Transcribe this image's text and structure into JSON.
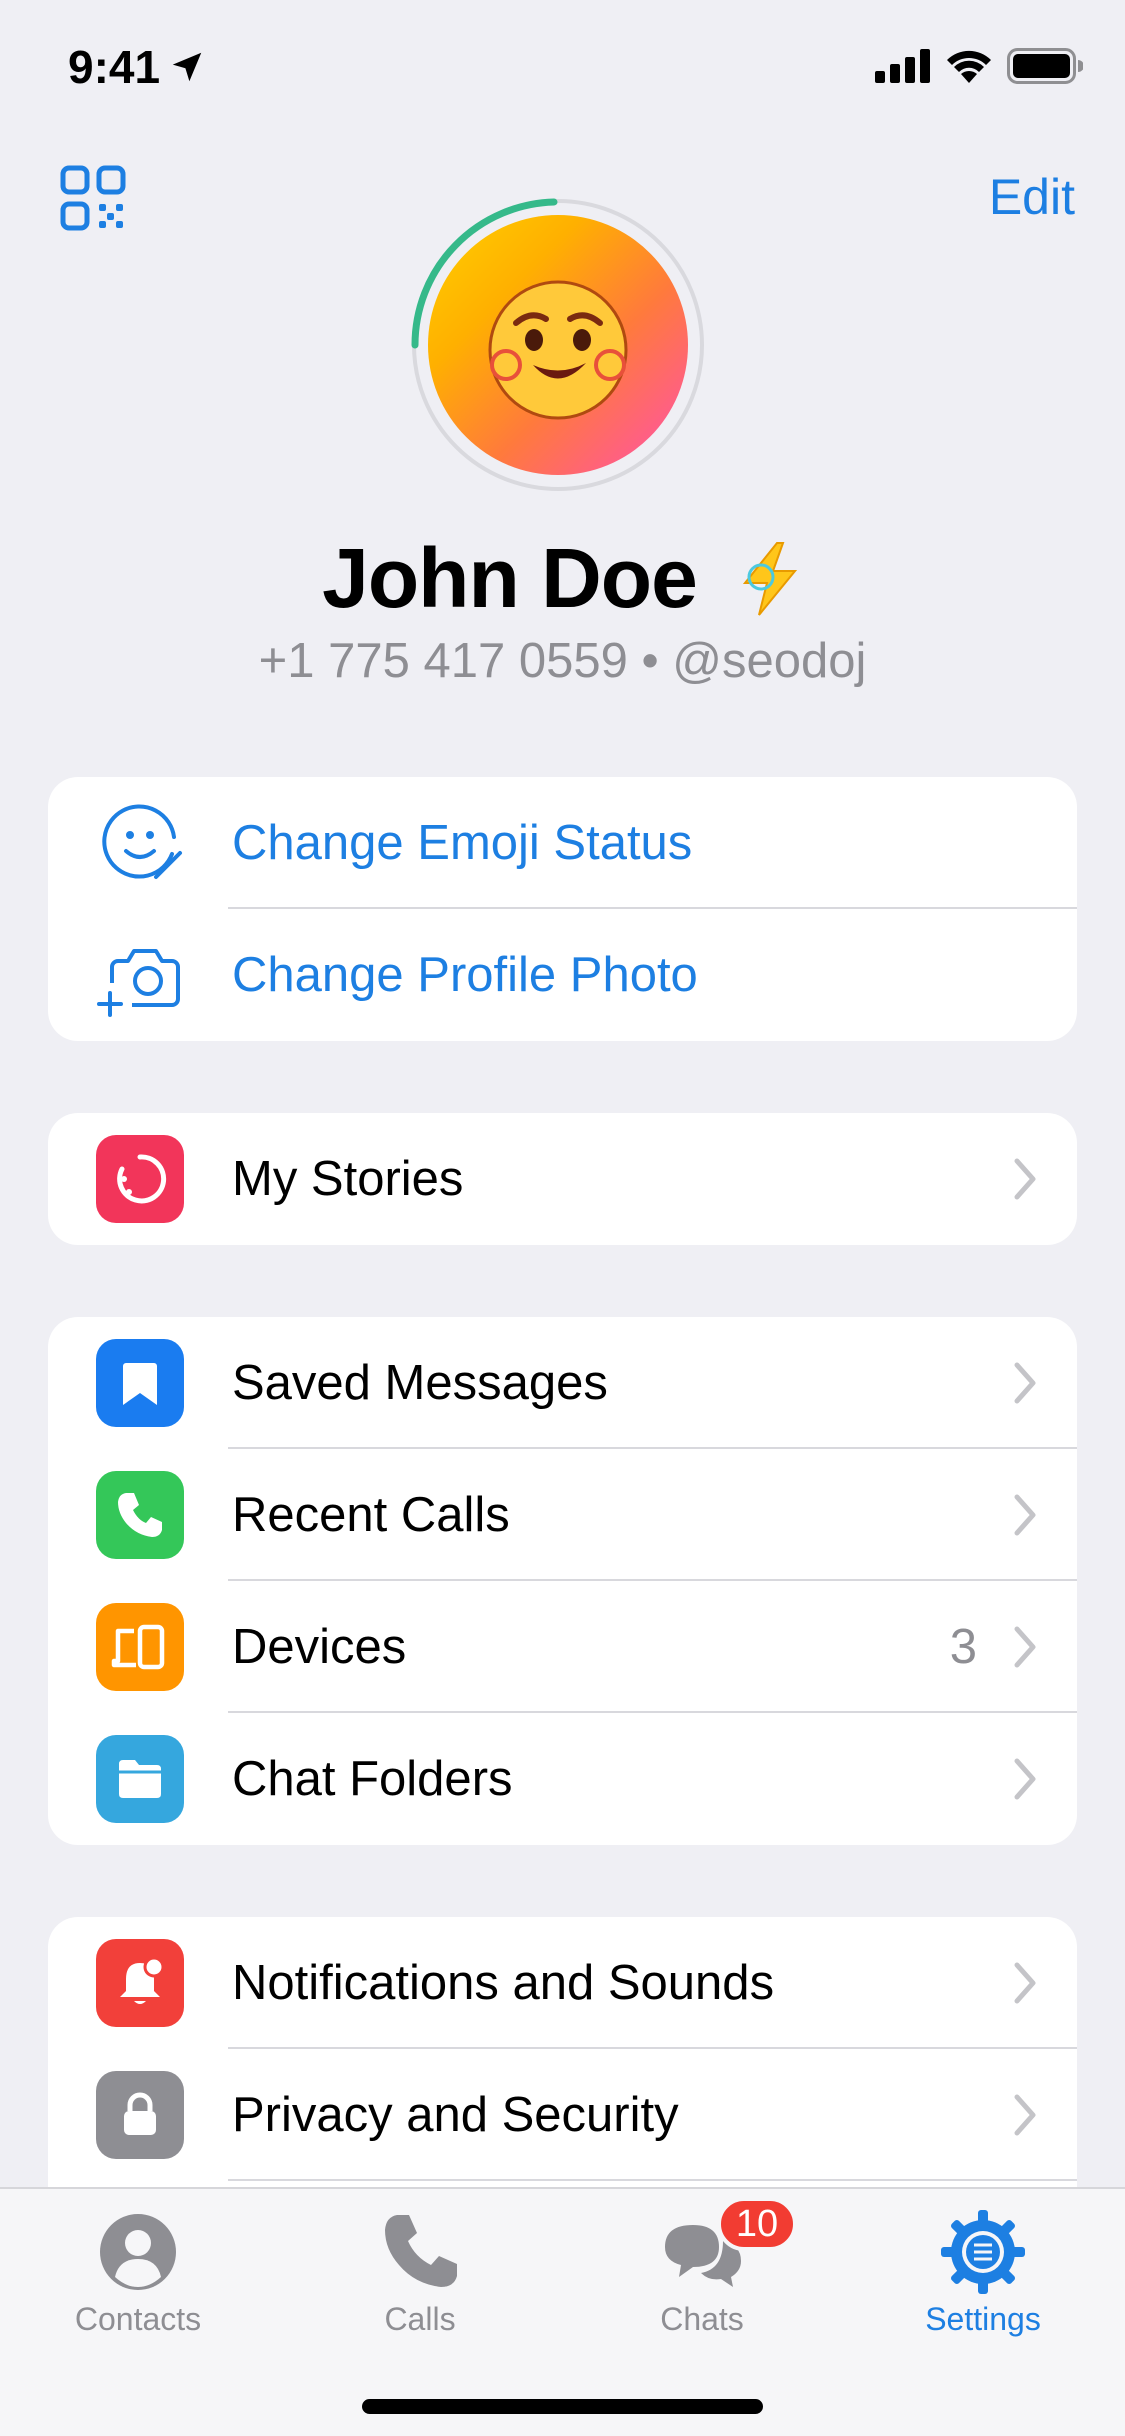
{
  "status_bar": {
    "time": "9:41"
  },
  "header": {
    "edit_label": "Edit"
  },
  "profile": {
    "name": "John Doe",
    "subtitle": "+1 775 417 0559 • @seodoj"
  },
  "actions": [
    {
      "label": "Change Emoji Status",
      "icon": "emoji-status-icon"
    },
    {
      "label": "Change Profile Photo",
      "icon": "camera-add-icon"
    }
  ],
  "stories": {
    "label": "My Stories",
    "icon": "stories-icon",
    "color": "#f2355a"
  },
  "main_items": [
    {
      "label": "Saved Messages",
      "icon": "bookmark-icon",
      "color": "#1a7cf0",
      "detail": ""
    },
    {
      "label": "Recent Calls",
      "icon": "phone-icon",
      "color": "#34c759",
      "detail": ""
    },
    {
      "label": "Devices",
      "icon": "devices-icon",
      "color": "#ff9500",
      "detail": "3"
    },
    {
      "label": "Chat Folders",
      "icon": "folder-icon",
      "color": "#35a7de",
      "detail": ""
    }
  ],
  "settings_items": [
    {
      "label": "Notifications and Sounds",
      "icon": "bell-icon",
      "color": "#f2403a"
    },
    {
      "label": "Privacy and Security",
      "icon": "lock-icon",
      "color": "#8e8e93"
    }
  ],
  "tab_bar": {
    "tabs": [
      {
        "label": "Contacts",
        "icon": "person-icon",
        "active": false
      },
      {
        "label": "Calls",
        "icon": "phone-icon",
        "active": false
      },
      {
        "label": "Chats",
        "icon": "chat-bubbles-icon",
        "active": false,
        "badge": "10"
      },
      {
        "label": "Settings",
        "icon": "gear-icon",
        "active": true
      }
    ]
  },
  "colors": {
    "accent": "#1d7fe2",
    "background": "#efeff4",
    "badge": "#f23c32"
  }
}
